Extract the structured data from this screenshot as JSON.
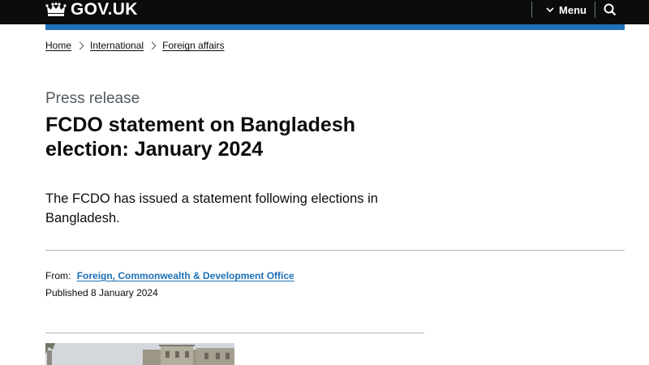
{
  "header": {
    "logo_text": "GOV.UK",
    "menu_label": "Menu",
    "colors": {
      "bar": "#0b0c0c",
      "accent": "#1d70b8"
    },
    "icons": {
      "logo": "crown-icon",
      "menu": "chevron-down-icon",
      "search": "search-icon"
    }
  },
  "breadcrumbs": [
    "Home",
    "International",
    "Foreign affairs"
  ],
  "caption": "Press release",
  "title": "FCDO statement on Bangladesh election: January 2024",
  "lede": "The FCDO has issued a statement following elections in Bangladesh.",
  "metadata": {
    "from_label": "From:",
    "from_org": "Foreign, Commonwealth & Development Office",
    "published": "Published 8 January 2024"
  }
}
